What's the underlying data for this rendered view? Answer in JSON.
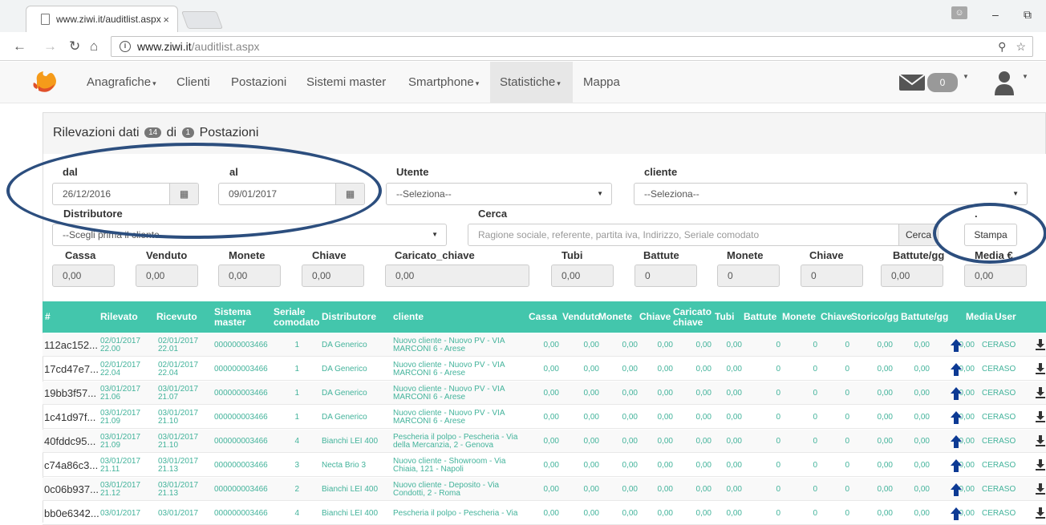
{
  "browser": {
    "tab_title": "www.ziwi.it/auditlist.aspx",
    "tab_close": "×",
    "url_host": "www.ziwi.it",
    "url_path": "/auditlist.aspx",
    "window_minimize": "–",
    "window_restore": "⧉"
  },
  "nav": {
    "items": [
      {
        "label": "Anagrafiche",
        "caret": true
      },
      {
        "label": "Clienti",
        "caret": false
      },
      {
        "label": "Postazioni",
        "caret": false
      },
      {
        "label": "Sistemi master",
        "caret": false
      },
      {
        "label": "Smartphone",
        "caret": true
      },
      {
        "label": "Statistiche",
        "caret": true,
        "active": true
      },
      {
        "label": "Mappa",
        "caret": false
      }
    ],
    "mail_count": "0"
  },
  "panel": {
    "title_part1": "Rilevazioni dati",
    "count1": "14",
    "title_part2": "di",
    "count2": "1",
    "title_part3": "Postazioni"
  },
  "filters": {
    "dal_label": "dal",
    "dal_value": "26/12/2016",
    "al_label": "al",
    "al_value": "09/01/2017",
    "utente_label": "Utente",
    "utente_value": "--Seleziona--",
    "cliente_label": "cliente",
    "cliente_value": "--Seleziona--",
    "distributore_label": "Distributore",
    "distributore_value": "--Scegli prima il cliente--",
    "cerca_label": "Cerca",
    "cerca_placeholder": "Ragione sociale, referente, partita iva, Indirizzo, Seriale comodato",
    "cerca_button": "Cerca",
    "dot_label": ".",
    "stampa_button": "Stampa"
  },
  "totals": [
    {
      "label": "Cassa",
      "value": "0,00"
    },
    {
      "label": "Venduto",
      "value": "0,00"
    },
    {
      "label": "Monete",
      "value": "0,00"
    },
    {
      "label": "Chiave",
      "value": "0,00"
    },
    {
      "label": "Caricato_chiave",
      "value": "0,00"
    },
    {
      "label": "Tubi",
      "value": "0,00"
    },
    {
      "label": "Battute",
      "value": "0"
    },
    {
      "label": "Monete",
      "value": "0"
    },
    {
      "label": "Chiave",
      "value": "0"
    },
    {
      "label": "Battute/gg",
      "value": "0,00"
    },
    {
      "label": "Media €",
      "value": "0,00"
    }
  ],
  "table": {
    "headers": [
      "#",
      "Rilevato",
      "Ricevuto",
      "Sistema master",
      "Seriale comodato",
      "Distributore",
      "cliente",
      "Cassa",
      "Venduto",
      "Monete",
      "Chiave",
      "Caricato chiave",
      "Tubi",
      "Battute",
      "Monete",
      "Chiave",
      "Storico/gg",
      "Battute/gg",
      "Media",
      "User"
    ],
    "rows": [
      {
        "id": "112ac152...",
        "rilevato": "02/01/2017 22.00",
        "ricevuto": "02/01/2017 22.01",
        "sistema": "000000003466",
        "seriale": "1",
        "distributore": "DA Generico",
        "cliente": "Nuovo cliente - Nuovo PV - VIA MARCONI 6 - Arese",
        "cassa": "0,00",
        "venduto": "0,00",
        "monete": "0,00",
        "chiave": "0,00",
        "caricato": "0,00",
        "tubi": "0,00",
        "battute": "0",
        "monete2": "0",
        "chiave2": "0",
        "storico": "0,00",
        "battute_gg": "0,00",
        "media": "0,00",
        "user": "CERASO"
      },
      {
        "id": "17cd47e7...",
        "rilevato": "02/01/2017 22.04",
        "ricevuto": "02/01/2017 22.04",
        "sistema": "000000003466",
        "seriale": "1",
        "distributore": "DA Generico",
        "cliente": "Nuovo cliente - Nuovo PV - VIA MARCONI 6 - Arese",
        "cassa": "0,00",
        "venduto": "0,00",
        "monete": "0,00",
        "chiave": "0,00",
        "caricato": "0,00",
        "tubi": "0,00",
        "battute": "0",
        "monete2": "0",
        "chiave2": "0",
        "storico": "0,00",
        "battute_gg": "0,00",
        "media": "0,00",
        "user": "CERASO"
      },
      {
        "id": "19bb3f57...",
        "rilevato": "03/01/2017 21.06",
        "ricevuto": "03/01/2017 21.07",
        "sistema": "000000003466",
        "seriale": "1",
        "distributore": "DA Generico",
        "cliente": "Nuovo cliente - Nuovo PV - VIA MARCONI 6 - Arese",
        "cassa": "0,00",
        "venduto": "0,00",
        "monete": "0,00",
        "chiave": "0,00",
        "caricato": "0,00",
        "tubi": "0,00",
        "battute": "0",
        "monete2": "0",
        "chiave2": "0",
        "storico": "0,00",
        "battute_gg": "0,00",
        "media": "0,00",
        "user": "CERASO"
      },
      {
        "id": "1c41d97f...",
        "rilevato": "03/01/2017 21.09",
        "ricevuto": "03/01/2017 21.10",
        "sistema": "000000003466",
        "seriale": "1",
        "distributore": "DA Generico",
        "cliente": "Nuovo cliente - Nuovo PV - VIA MARCONI 6 - Arese",
        "cassa": "0,00",
        "venduto": "0,00",
        "monete": "0,00",
        "chiave": "0,00",
        "caricato": "0,00",
        "tubi": "0,00",
        "battute": "0",
        "monete2": "0",
        "chiave2": "0",
        "storico": "0,00",
        "battute_gg": "0,00",
        "media": "0,00",
        "user": "CERASO"
      },
      {
        "id": "40fddc95...",
        "rilevato": "03/01/2017 21.09",
        "ricevuto": "03/01/2017 21.10",
        "sistema": "000000003466",
        "seriale": "4",
        "distributore": "Bianchi LEI 400",
        "cliente": "Pescheria il polpo - Pescheria - Via della Mercanzia, 2 - Genova",
        "cassa": "0,00",
        "venduto": "0,00",
        "monete": "0,00",
        "chiave": "0,00",
        "caricato": "0,00",
        "tubi": "0,00",
        "battute": "0",
        "monete2": "0",
        "chiave2": "0",
        "storico": "0,00",
        "battute_gg": "0,00",
        "media": "0,00",
        "user": "CERASO"
      },
      {
        "id": "c74a86c3...",
        "rilevato": "03/01/2017 21.11",
        "ricevuto": "03/01/2017 21.13",
        "sistema": "000000003466",
        "seriale": "3",
        "distributore": "Necta Brio 3",
        "cliente": "Nuovo cliente - Showroom - Via Chiaia, 121 - Napoli",
        "cassa": "0,00",
        "venduto": "0,00",
        "monete": "0,00",
        "chiave": "0,00",
        "caricato": "0,00",
        "tubi": "0,00",
        "battute": "0",
        "monete2": "0",
        "chiave2": "0",
        "storico": "0,00",
        "battute_gg": "0,00",
        "media": "0,00",
        "user": "CERASO"
      },
      {
        "id": "0c06b937...",
        "rilevato": "03/01/2017 21.12",
        "ricevuto": "03/01/2017 21.13",
        "sistema": "000000003466",
        "seriale": "2",
        "distributore": "Bianchi LEI 400",
        "cliente": "Nuovo cliente - Deposito - Via Condotti, 2 - Roma",
        "cassa": "0,00",
        "venduto": "0,00",
        "monete": "0,00",
        "chiave": "0,00",
        "caricato": "0,00",
        "tubi": "0,00",
        "battute": "0",
        "monete2": "0",
        "chiave2": "0",
        "storico": "0,00",
        "battute_gg": "0,00",
        "media": "0,00",
        "user": "CERASO"
      },
      {
        "id": "bb0e6342...",
        "rilevato": "03/01/2017",
        "ricevuto": "03/01/2017",
        "sistema": "000000003466",
        "seriale": "4",
        "distributore": "Bianchi LEI 400",
        "cliente": "Pescheria il polpo - Pescheria - Via",
        "cassa": "0,00",
        "venduto": "0,00",
        "monete": "0,00",
        "chiave": "0,00",
        "caricato": "0,00",
        "tubi": "0,00",
        "battute": "0",
        "monete2": "0",
        "chiave2": "0",
        "storico": "0,00",
        "battute_gg": "0,00",
        "media": "0,00",
        "user": "CERASO"
      }
    ]
  },
  "colors": {
    "table_header": "#43c6ac",
    "link_text": "#43b39b",
    "annotation": "#2c4e7e",
    "arrow": "#0d3a94"
  }
}
